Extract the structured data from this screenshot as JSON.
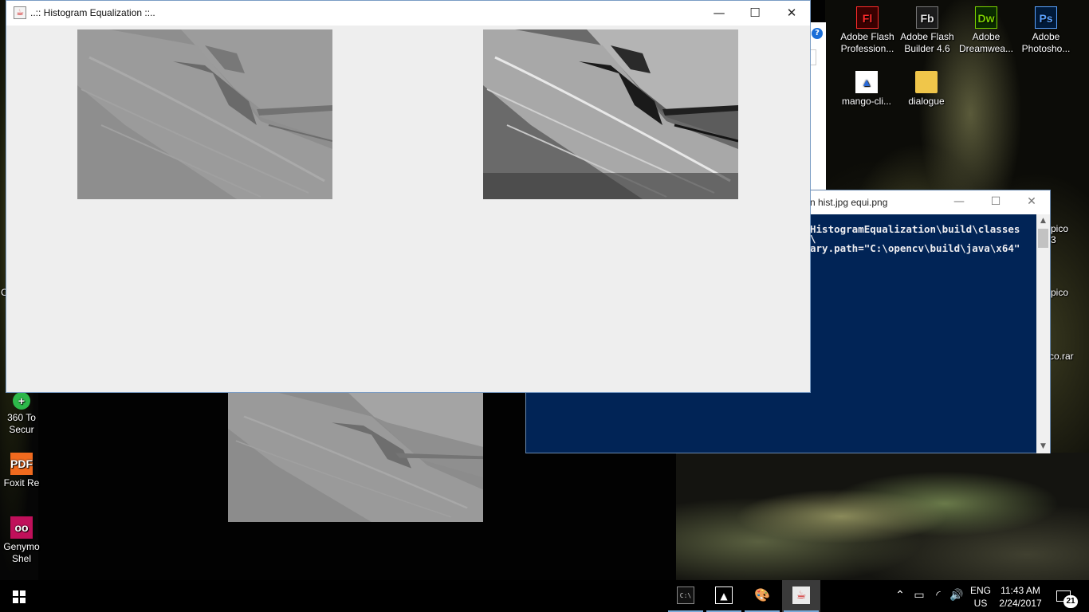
{
  "desktop_icons": [
    {
      "name": "adobe-flash-professional",
      "label_l1": "Adobe Flash",
      "label_l2": "Profession...",
      "glyph": "Fl"
    },
    {
      "name": "adobe-flash-builder",
      "label_l1": "Adobe Flash",
      "label_l2": "Builder 4.6",
      "glyph": "Fb"
    },
    {
      "name": "adobe-dreamweaver",
      "label_l1": "Adobe",
      "label_l2": "Dreamwea...",
      "glyph": "Dw"
    },
    {
      "name": "adobe-photoshop",
      "label_l1": "Adobe",
      "label_l2": "Photosho...",
      "glyph": "Ps"
    },
    {
      "name": "mango-cli",
      "label_l1": "mango-cli...",
      "label_l2": "",
      "glyph": ""
    },
    {
      "name": "dialogue",
      "label_l1": "dialogue",
      "label_l2": "",
      "glyph": ""
    }
  ],
  "left_icons": [
    {
      "label_l1": "360 To",
      "label_l2": "Secur",
      "glyph": "+"
    },
    {
      "label_l1": "Foxit Re",
      "label_l2": "",
      "glyph": "PDF"
    },
    {
      "label_l1": "Genymo",
      "label_l2": "Shel",
      "glyph": "oo"
    }
  ],
  "right_partial_labels": [
    "pico",
    "3",
    "pico",
    "co.rar"
  ],
  "left_partial_label": "C",
  "main_window": {
    "title": "..:: Histogram Equalization ::..",
    "minimize": "—",
    "maximize": "☐",
    "close": "✕"
  },
  "console": {
    "title": "n hist.jpg equi.png",
    "lines": [
      "HistogramEqualization\\build\\classes",
      "\\",
      "ary.path=\"C:\\opencv\\build\\java\\x64\""
    ],
    "minimize": "—",
    "maximize": "☐",
    "close": "✕"
  },
  "taskbar": {
    "apps": [
      {
        "name": "command-prompt",
        "glyph": "C:\\"
      },
      {
        "name": "photos",
        "glyph": "▲"
      },
      {
        "name": "paint",
        "glyph": "🎨"
      },
      {
        "name": "java",
        "glyph": "☕"
      }
    ],
    "language": "ENG",
    "region": "US",
    "time": "11:43 AM",
    "date": "2/24/2017",
    "notification_count": "21"
  },
  "colors": {
    "console_bg": "#012456",
    "window_bg": "#eeeeee",
    "taskbar_bg": "#000000"
  }
}
